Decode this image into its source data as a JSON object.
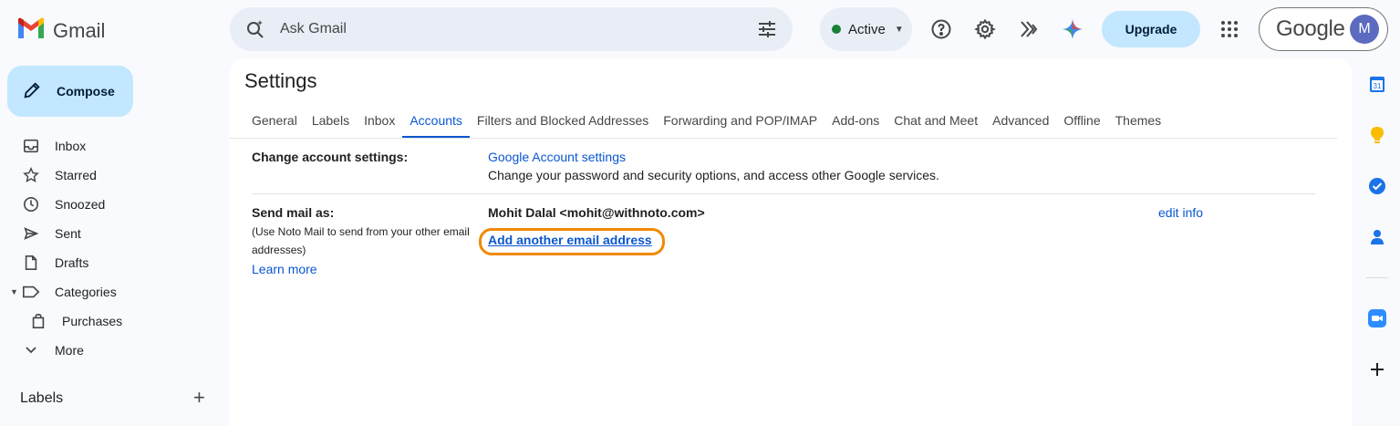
{
  "app": {
    "name": "Gmail"
  },
  "search": {
    "placeholder": "Ask Gmail"
  },
  "status": {
    "label": "Active",
    "color": "#188038"
  },
  "header": {
    "upgrade_label": "Upgrade",
    "google_wordmark": "Google",
    "avatar_initial": "M",
    "icons": [
      "help-icon",
      "settings-icon",
      "activity-icon",
      "gemini-icon",
      "apps-grid-icon"
    ]
  },
  "compose": {
    "label": "Compose"
  },
  "nav": {
    "items": [
      {
        "label": "Inbox",
        "icon": "inbox-icon"
      },
      {
        "label": "Starred",
        "icon": "star-icon"
      },
      {
        "label": "Snoozed",
        "icon": "clock-icon"
      },
      {
        "label": "Sent",
        "icon": "send-icon"
      },
      {
        "label": "Drafts",
        "icon": "draft-icon"
      },
      {
        "label": "Categories",
        "icon": "label-icon"
      },
      {
        "label": "Purchases",
        "icon": "shopping-bag-icon"
      },
      {
        "label": "More",
        "icon": "chevron-down-icon"
      }
    ],
    "labels_heading": "Labels"
  },
  "settings": {
    "title": "Settings",
    "tabs": [
      {
        "label": "General"
      },
      {
        "label": "Labels"
      },
      {
        "label": "Inbox"
      },
      {
        "label": "Accounts",
        "active": true
      },
      {
        "label": "Filters and Blocked Addresses"
      },
      {
        "label": "Forwarding and POP/IMAP"
      },
      {
        "label": "Add-ons"
      },
      {
        "label": "Chat and Meet"
      },
      {
        "label": "Advanced"
      },
      {
        "label": "Offline"
      },
      {
        "label": "Themes"
      }
    ],
    "change_account": {
      "label": "Change account settings:",
      "link": "Google Account settings",
      "description": "Change your password and security options, and access other Google services."
    },
    "send_mail_as": {
      "label": "Send mail as:",
      "help_line1": "(Use Noto Mail to send from your other email",
      "help_line2": "addresses)",
      "learn_more": "Learn more",
      "identity": "Mohit Dalal <mohit@withnoto.com>",
      "add_link": "Add another email address",
      "edit_link": "edit info"
    }
  },
  "right_rail": {
    "icons": [
      "calendar-icon",
      "keep-icon",
      "tasks-icon",
      "contacts-icon",
      "zoom-icon",
      "add-icon"
    ],
    "calendar_day": "31"
  },
  "colors": {
    "accent": "#0b57d0",
    "highlight": "#f08a00",
    "compose_bg": "#c2e7ff"
  }
}
